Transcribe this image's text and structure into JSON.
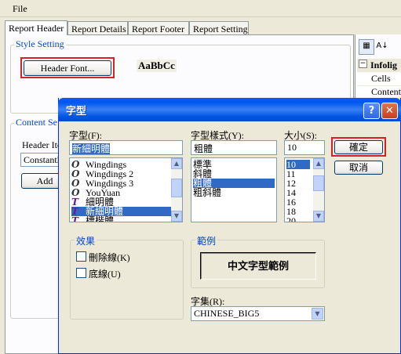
{
  "menu": {
    "file": "File"
  },
  "tabs": [
    "Report Header",
    "Report Details",
    "Report Footer",
    "Report Setting"
  ],
  "style_setting": {
    "title": "Style Setting",
    "header_font_button": "Header Font...",
    "sample": "AaBbCc"
  },
  "content_setting": {
    "title": "Content Se",
    "header_item_label": "Header Ite",
    "header_item_value": "Constantl",
    "add_button": "Add"
  },
  "property_grid": {
    "category": "Infolig",
    "rows": [
      "Cells",
      "Content"
    ]
  },
  "dialog": {
    "title": "字型",
    "font_label": "字型(F):",
    "font_value": "新細明體",
    "font_list": [
      {
        "icon": "O",
        "name": "Wingdings"
      },
      {
        "icon": "O",
        "name": "Wingdings 2"
      },
      {
        "icon": "O",
        "name": "Wingdings 3"
      },
      {
        "icon": "O",
        "name": "YouYuan"
      },
      {
        "icon": "T",
        "name": "細明體"
      },
      {
        "icon": "T",
        "name": "新細明體"
      },
      {
        "icon": "T",
        "name": "標楷體"
      }
    ],
    "font_selected_index": 5,
    "style_label": "字型樣式(Y):",
    "style_value": "粗體",
    "style_list": [
      "標準",
      "斜體",
      "粗體",
      "粗斜體"
    ],
    "style_selected_index": 2,
    "size_label": "大小(S):",
    "size_value": "10",
    "size_list": [
      "10",
      "11",
      "12",
      "14",
      "16",
      "18",
      "20"
    ],
    "size_selected_index": 0,
    "ok_button": "確定",
    "cancel_button": "取消",
    "effects_title": "效果",
    "strikeout_label": "刪除線(K)",
    "underline_label": "底線(U)",
    "sample_title": "範例",
    "sample_text": "中文字型範例",
    "script_label": "字集(R):",
    "script_value": "CHINESE_BIG5"
  },
  "colors": {
    "highlight_border": "#d8202a",
    "selection": "#316ac5",
    "titlebar": "#0058ee",
    "group_title": "#0046d5"
  }
}
